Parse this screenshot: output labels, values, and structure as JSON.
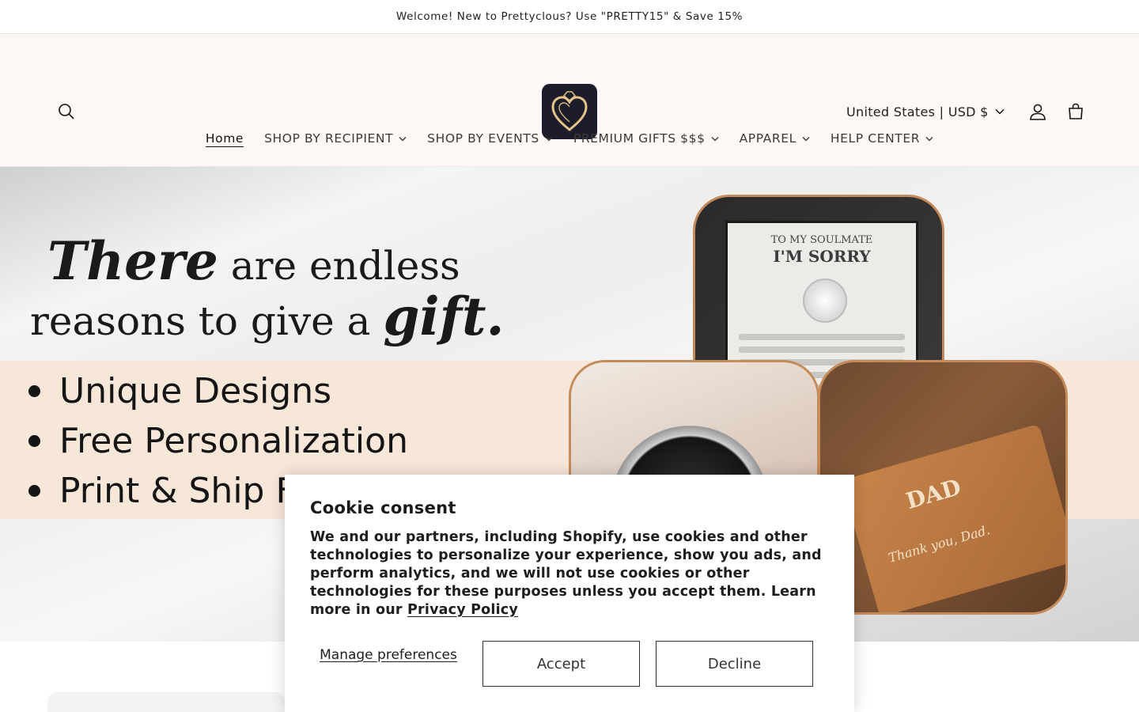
{
  "announcement": {
    "text": "Welcome! New to Prettyclous? Use \"PRETTY15\" & Save 15%"
  },
  "header": {
    "search_icon": "search-icon",
    "country_selector": "United States | USD $",
    "account_icon": "account-icon",
    "cart_icon": "cart-icon"
  },
  "nav": {
    "items": [
      {
        "label": "Home"
      },
      {
        "label": "SHOP BY RECIPIENT"
      },
      {
        "label": "SHOP BY EVENTS"
      },
      {
        "label": "PREMIUM GIFTS $$$"
      },
      {
        "label": "APPAREL"
      },
      {
        "label": "HELP CENTER"
      }
    ]
  },
  "hero": {
    "line1_script": "There",
    "line1_rest": "are endless",
    "line2_rest": "reasons to give a",
    "line2_script": "gift.",
    "bullets": [
      "Unique Designs",
      "Free Personalization",
      "Print & Ship Fr"
    ],
    "necklace_card": {
      "line1": "TO MY SOULMATE",
      "line2": "I'M SORRY"
    },
    "wallet_card": {
      "title": "DAD",
      "tagline": "Thank you, Dad."
    }
  },
  "cookie": {
    "title": "Cookie consent",
    "body": "We and our partners, including Shopify, use cookies and other technologies to personalize your experience, show you ads, and perform analytics, and we will not use cookies or other technologies for these purposes unless you accept them. Learn more in our ",
    "link": "Privacy Policy",
    "manage": "Manage preferences",
    "accept": "Accept",
    "decline": "Decline"
  }
}
